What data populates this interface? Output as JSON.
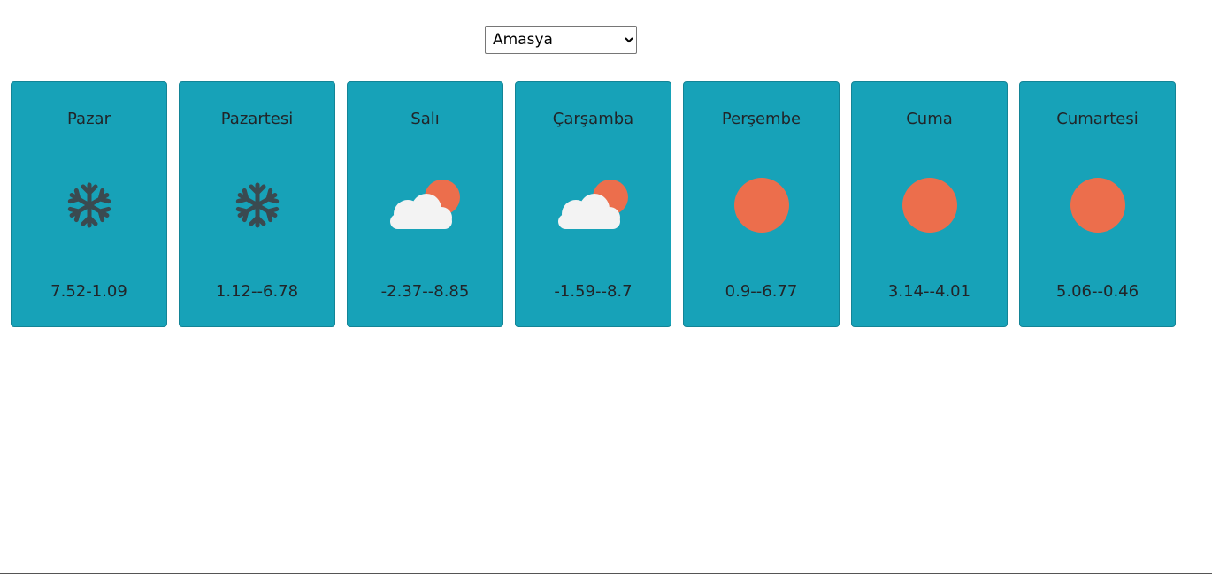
{
  "city_select": {
    "selected": "Amasya"
  },
  "days": [
    {
      "name": "Pazar",
      "temp": "7.52-1.09",
      "icon": "snowflake-icon"
    },
    {
      "name": "Pazartesi",
      "temp": "1.12--6.78",
      "icon": "snowflake-icon"
    },
    {
      "name": "Salı",
      "temp": "-2.37--8.85",
      "icon": "partly-cloudy-icon"
    },
    {
      "name": "Çarşamba",
      "temp": "-1.59--8.7",
      "icon": "partly-cloudy-icon"
    },
    {
      "name": "Perşembe",
      "temp": "0.9--6.77",
      "icon": "sun-icon"
    },
    {
      "name": "Cuma",
      "temp": "3.14--4.01",
      "icon": "sun-icon"
    },
    {
      "name": "Cumartesi",
      "temp": "5.06--0.46",
      "icon": "sun-icon"
    }
  ],
  "colors": {
    "card_bg": "#17a2b8",
    "sun": "#ec6e4c",
    "cloud": "#f3f3f3",
    "snow": "#3a4a50"
  }
}
